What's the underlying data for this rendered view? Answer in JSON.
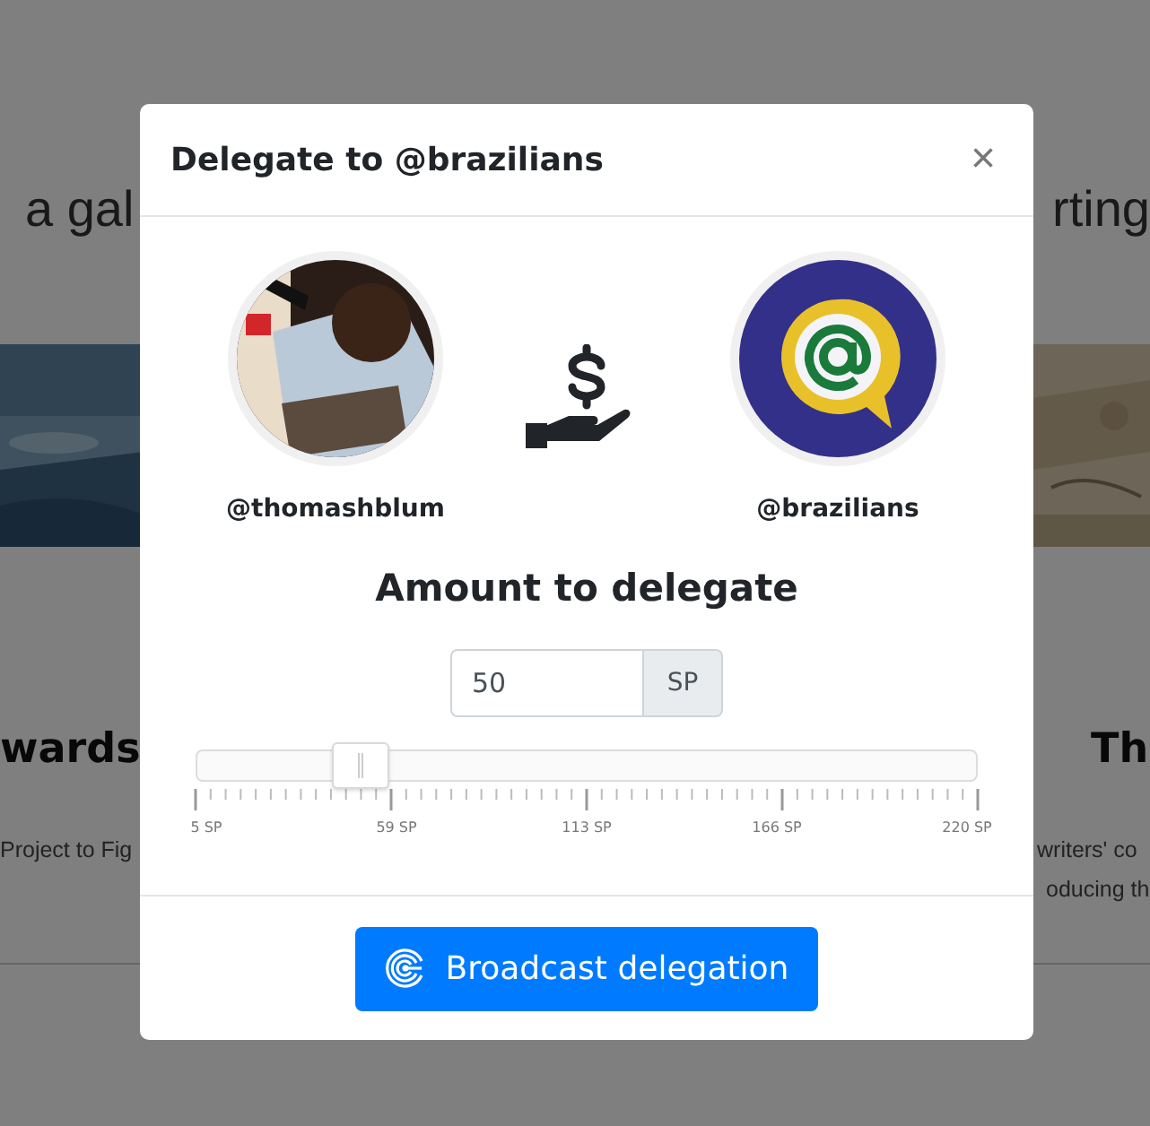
{
  "background": {
    "subtitle_left": "a gal",
    "subtitle_right": "rting",
    "cards": [
      {
        "title": "wards",
        "text_lines": [
          "Project to Fig"
        ]
      },
      {
        "title": "Th",
        "text_lines": [
          "writers' co",
          "oducing th"
        ]
      }
    ]
  },
  "modal": {
    "title": "Delegate to @brazilians",
    "close": "×",
    "from": {
      "username": "@thomashblum"
    },
    "to": {
      "username": "@brazilians"
    },
    "heading": "Amount to delegate",
    "amount": {
      "value": "50",
      "unit": "SP"
    },
    "slider": {
      "level": 0.209,
      "tick_labels": [
        "5 SP",
        "59 SP",
        "113 SP",
        "166 SP",
        "220 SP"
      ]
    },
    "submit": "Broadcast delegation"
  }
}
